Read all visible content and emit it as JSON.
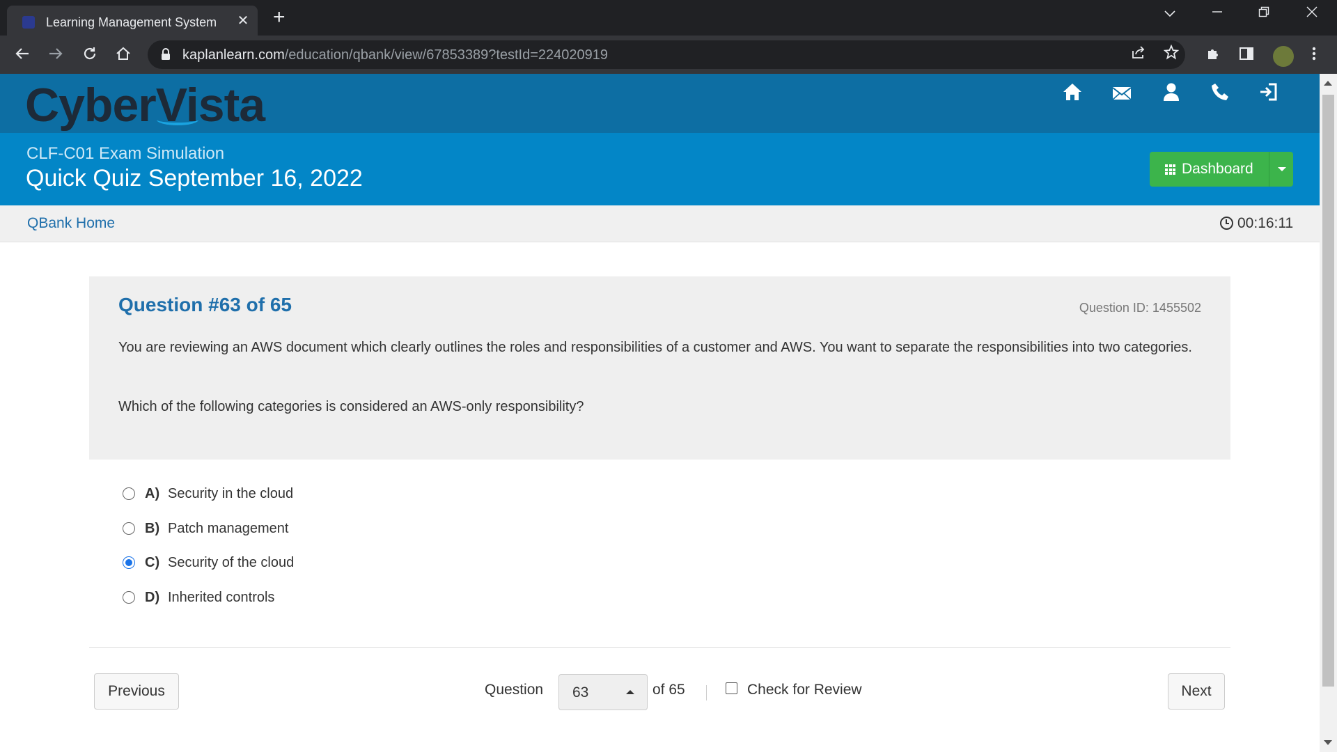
{
  "browser": {
    "tab_title": "Learning Management System",
    "tab_close": "✕",
    "new_tab": "+",
    "url_domain": "kaplanlearn.com",
    "url_path": "/education/qbank/view/67853389?testId=224020919"
  },
  "site": {
    "logo": "CyberVista"
  },
  "header": {
    "exam_name": "CLF-C01 Exam Simulation",
    "quiz_title": "Quick Quiz September 16, 2022",
    "dashboard_label": "Dashboard"
  },
  "subnav": {
    "home_link": "QBank Home",
    "timer": "00:16:11"
  },
  "question": {
    "heading": "Question #63 of 65",
    "id_label": "Question ID: 1455502",
    "text": "You are reviewing an AWS document which clearly outlines the roles and responsibilities of a customer and AWS. You want to separate the responsibilities into two categories.",
    "prompt": "Which of the following categories is considered an AWS-only responsibility?"
  },
  "answers": [
    {
      "letter": "A)",
      "text": "Security in the cloud",
      "selected": false
    },
    {
      "letter": "B)",
      "text": "Patch management",
      "selected": false
    },
    {
      "letter": "C)",
      "text": "Security of the cloud",
      "selected": true
    },
    {
      "letter": "D)",
      "text": "Inherited controls",
      "selected": false
    }
  ],
  "footer": {
    "previous_label": "Previous",
    "question_label": "Question",
    "current_question": "63",
    "of_total": "of 65",
    "review_label": "Check for Review",
    "review_checked": false,
    "next_label": "Next"
  },
  "colors": {
    "brand_bar": "#0d6ea3",
    "title_bar": "#0386c7",
    "dashboard_button": "#3cb44b",
    "question_heading": "#1f6fab"
  }
}
